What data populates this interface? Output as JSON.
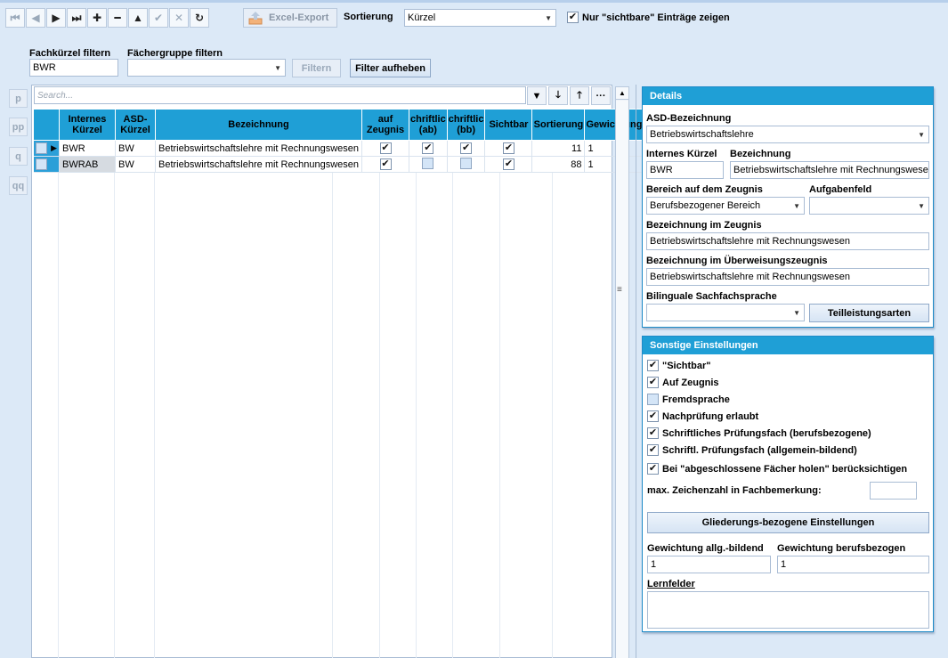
{
  "toolbar": {
    "nav_icons": [
      "first-icon",
      "prev-icon",
      "next-icon",
      "last-icon",
      "add-icon",
      "remove-icon",
      "up-icon",
      "confirm-icon",
      "cancel-icon",
      "refresh-icon"
    ],
    "excel_label": "Excel-Export",
    "sort_label": "Sortierung",
    "sort_value": "Kürzel",
    "visible_only_label": "Nur \"sichtbare\" Einträge zeigen"
  },
  "filters": {
    "kuerzel_label": "Fachkürzel filtern",
    "kuerzel_value": "BWR",
    "group_label": "Fächergruppe filtern",
    "group_value": "",
    "filter_button": "Filtern",
    "clear_button": "Filter aufheben"
  },
  "side": {
    "buttons": [
      "p",
      "pp",
      "q",
      "qq"
    ]
  },
  "grid": {
    "search_placeholder": "Search...",
    "columns": [
      "Internes Kürzel",
      "ASD-Kürzel",
      "Bezeichnung",
      "auf Zeugnis",
      "chriftlic (ab)",
      "chriftlic (bb)",
      "Sichtbar",
      "Sortierung",
      "Gewichtung"
    ],
    "col_internes_1": "Internes",
    "col_internes_2": "Kürzel",
    "col_asd_1": "ASD-",
    "col_asd_2": "Kürzel",
    "col_bez": "Bezeichnung",
    "col_zeug_1": "auf",
    "col_zeug_2": "Zeugnis",
    "col_ab_1": "chriftlic",
    "col_ab_2": "(ab)",
    "col_bb_1": "chriftlic",
    "col_bb_2": "(bb)",
    "col_sicht": "Sichtbar",
    "col_sort": "Sortierung",
    "col_gew": "Gewichtung",
    "rows": [
      {
        "intern": "BWR",
        "asd": "BW",
        "bez": "Betriebswirtschaftslehre mit Rechnungswesen",
        "zeugnis": true,
        "ab": true,
        "bb": true,
        "sichtbar": true,
        "sort": "11",
        "gew": "1"
      },
      {
        "intern": "BWRAB",
        "asd": "BW",
        "bez": "Betriebswirtschaftslehre mit Rechnungswesen",
        "zeugnis": true,
        "ab": false,
        "bb": false,
        "sichtbar": true,
        "sort": "88",
        "gew": "1"
      }
    ]
  },
  "details": {
    "title": "Details",
    "asd_label": "ASD-Bezeichnung",
    "asd_value": "Betriebswirtschaftslehre",
    "intern_label": "Internes Kürzel",
    "intern_value": "BWR",
    "bez_label": "Bezeichnung",
    "bez_value": "Betriebswirtschaftslehre mit Rechnungswesen",
    "bereich_label": "Bereich auf dem Zeugnis",
    "bereich_value": "Berufsbezogener Bereich",
    "aufgaben_label": "Aufgabenfeld",
    "aufgaben_value": "",
    "bez_zeugnis_label": "Bezeichnung im Zeugnis",
    "bez_zeugnis_value": "Betriebswirtschaftslehre mit Rechnungswesen",
    "bez_ueber_label": "Bezeichnung im Überweisungszeugnis",
    "bez_ueber_value": "Betriebswirtschaftslehre mit Rechnungswesen",
    "bilingual_label": "Bilinguale Sachfachsprache",
    "bilingual_value": "",
    "teil_button": "Teilleistungsarten"
  },
  "sonstige": {
    "title": "Sonstige Einstellungen",
    "checks": [
      {
        "label": "\"Sichtbar\"",
        "checked": true
      },
      {
        "label": "Auf Zeugnis",
        "checked": true
      },
      {
        "label": "Fremdsprache",
        "checked": false
      },
      {
        "label": "Nachprüfung erlaubt",
        "checked": true
      },
      {
        "label": "Schriftliches Prüfungsfach (berufsbezogene)",
        "checked": true
      },
      {
        "label": "Schriftl. Prüfungsfach (allgemein-bildend)",
        "checked": true
      },
      {
        "label": "Bei \"abgeschlossene Fächer holen\" berücksichtigen",
        "checked": true
      }
    ],
    "max_label": "max. Zeichenzahl in Fachbemerkung:",
    "max_value": "",
    "glied_button": "Gliederungs-bezogene Einstellungen",
    "gew_allg_label": "Gewichtung allg.-bildend",
    "gew_allg_value": "1",
    "gew_beruf_label": "Gewichtung berufsbezogen",
    "gew_beruf_value": "1",
    "lernfelder_label": "Lernfelder",
    "lernfelder_value": ""
  },
  "colors": {
    "accent": "#1f9fd6",
    "background": "#dce9f7"
  }
}
